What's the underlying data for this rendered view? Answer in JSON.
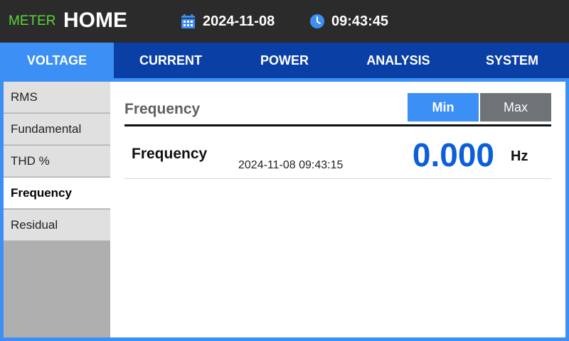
{
  "header": {
    "app_label": "METER",
    "title": "HOME",
    "date": "2024-11-08",
    "time": "09:43:45",
    "icons": {
      "date": "calendar-icon",
      "time": "clock-icon"
    }
  },
  "tabs": [
    {
      "label": "VOLTAGE",
      "active": true
    },
    {
      "label": "CURRENT",
      "active": false
    },
    {
      "label": "POWER",
      "active": false
    },
    {
      "label": "ANALYSIS",
      "active": false
    },
    {
      "label": "SYSTEM",
      "active": false
    }
  ],
  "sidebar": {
    "items": [
      {
        "label": "RMS",
        "active": false
      },
      {
        "label": "Fundamental",
        "active": false
      },
      {
        "label": "THD %",
        "active": false
      },
      {
        "label": "Frequency",
        "active": true
      },
      {
        "label": "Residual",
        "active": false
      }
    ]
  },
  "main": {
    "title": "Frequency",
    "min_label": "Min",
    "max_label": "Max",
    "selected_mode": "Min",
    "reading": {
      "label": "Frequency",
      "timestamp": "2024-11-08 09:43:15",
      "value": "0.000",
      "unit": "Hz"
    }
  },
  "colors": {
    "header_bg": "#2b2b2b",
    "app_label": "#5ed63a",
    "tab_bar": "#0a3fa6",
    "accent": "#3c8ff5",
    "value": "#0d5fd8",
    "max_button": "#6e7378"
  }
}
